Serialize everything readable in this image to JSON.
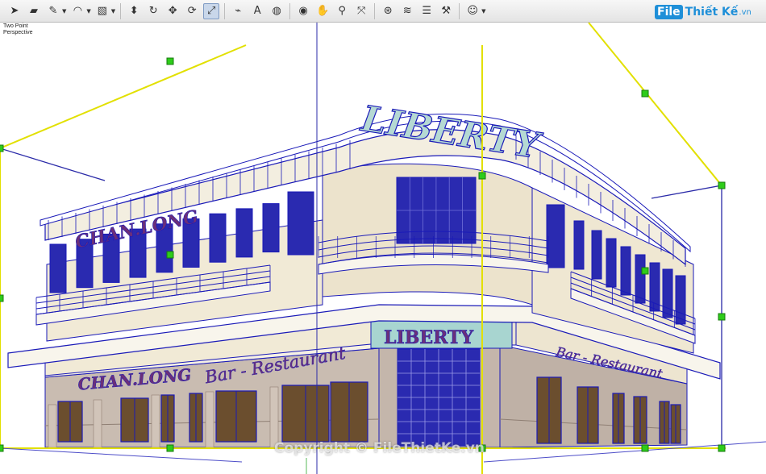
{
  "toolbar": {
    "groups": [
      [
        {
          "name": "select-icon",
          "glyph": "➤",
          "drop": false
        },
        {
          "name": "eraser-icon",
          "glyph": "▰",
          "drop": false
        },
        {
          "name": "pencil-icon",
          "glyph": "✎",
          "drop": true
        },
        {
          "name": "arc-icon",
          "glyph": "◠",
          "drop": true
        },
        {
          "name": "shape-icon",
          "glyph": "▧",
          "drop": true
        }
      ],
      [
        {
          "name": "push-pull-icon",
          "glyph": "⬍",
          "drop": false
        },
        {
          "name": "follow-me-icon",
          "glyph": "↻",
          "drop": false
        },
        {
          "name": "move-icon",
          "glyph": "✥",
          "drop": false
        },
        {
          "name": "rotate-icon",
          "glyph": "⟳",
          "drop": false
        },
        {
          "name": "scale-icon",
          "glyph": "⤢",
          "drop": false,
          "active": true
        }
      ],
      [
        {
          "name": "tape-measure-icon",
          "glyph": "⌁",
          "drop": false
        },
        {
          "name": "text-icon",
          "glyph": "A",
          "drop": false
        },
        {
          "name": "paint-bucket-icon",
          "glyph": "◍",
          "drop": false
        }
      ],
      [
        {
          "name": "orbit-icon",
          "glyph": "◉",
          "drop": false
        },
        {
          "name": "pan-icon",
          "glyph": "✋",
          "drop": false
        },
        {
          "name": "zoom-icon",
          "glyph": "⚲",
          "drop": false
        },
        {
          "name": "zoom-extents-icon",
          "glyph": "⤧",
          "drop": false
        }
      ],
      [
        {
          "name": "warehouse-icon",
          "glyph": "⊛",
          "drop": false
        },
        {
          "name": "extension-icon",
          "glyph": "≋",
          "drop": false
        },
        {
          "name": "layers-icon",
          "glyph": "☰",
          "drop": false
        },
        {
          "name": "sandbox-icon",
          "glyph": "⚒",
          "drop": false
        }
      ],
      [
        {
          "name": "account-icon",
          "glyph": "☺",
          "drop": true
        }
      ]
    ]
  },
  "viewport": {
    "camera_line1": "Two Point",
    "camera_line2": "Perspective"
  },
  "building": {
    "roof_sign": "LIBERTY",
    "corner_sign": "LIBERTY",
    "left_upper_sign": "CHAN.LONG",
    "left_lower_sign": "CHAN.LONG",
    "bar_sign_left": "Bar - Restaurant",
    "bar_sign_right": "Bar - Restaurant"
  },
  "colors": {
    "outline": "#1a1ab8",
    "window_fill": "#2a2ab0",
    "wall": "#f1ead6",
    "stone": "#c7b9ae",
    "sign_text": "#6b2f7a",
    "guide_yellow": "#e2e000",
    "guide_blue": "#2a2aa8",
    "handle_green": "#2ecc1a"
  },
  "logo": {
    "box": "File",
    "text": "Thiết Kế",
    "suffix": ".vn"
  },
  "watermark": "Copyright © FileThietKe.vn"
}
